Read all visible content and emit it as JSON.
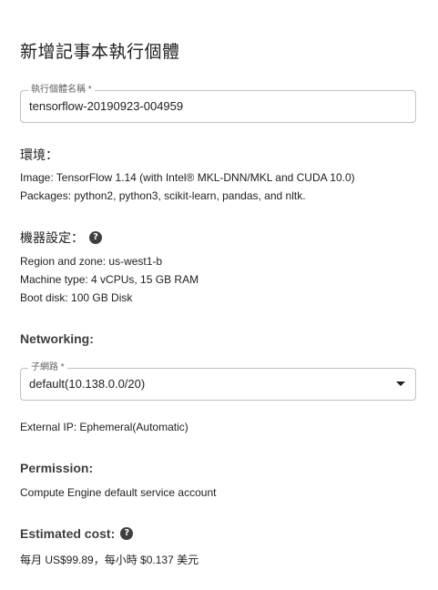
{
  "dialog": {
    "title": "新增記事本執行個體"
  },
  "instance_name": {
    "label": "執行個體名稱 *",
    "value": "tensorflow-20190923-004959"
  },
  "environment": {
    "heading": "環境：",
    "image_line": "Image: TensorFlow 1.14 (with Intel® MKL-DNN/MKL and CUDA 10.0)",
    "packages_line": "Packages: python2, python3, scikit-learn, pandas, and nltk."
  },
  "machine": {
    "heading": "機器設定：",
    "help_icon": "help-circle-icon",
    "help_glyph": "?",
    "region_line": "Region and zone: us-west1-b",
    "machine_type_line": "Machine type: 4 vCPUs, 15 GB RAM",
    "boot_disk_line": "Boot disk: 100 GB Disk"
  },
  "networking": {
    "heading": "Networking:",
    "subnet_label": "子網路 *",
    "subnet_value": "default(10.138.0.0/20)",
    "external_ip_line": "External IP: Ephemeral(Automatic)"
  },
  "permission": {
    "heading": "Permission:",
    "account_line": "Compute Engine default service account"
  },
  "cost": {
    "heading": "Estimated cost:",
    "help_icon": "help-circle-icon",
    "help_glyph": "?",
    "estimate_line": "每月 US$99.89，每小時 $0.137 美元"
  },
  "colors": {
    "text": "#202124",
    "border": "#bdc1c6",
    "label": "#5f6368",
    "icon": "#3c4043"
  }
}
